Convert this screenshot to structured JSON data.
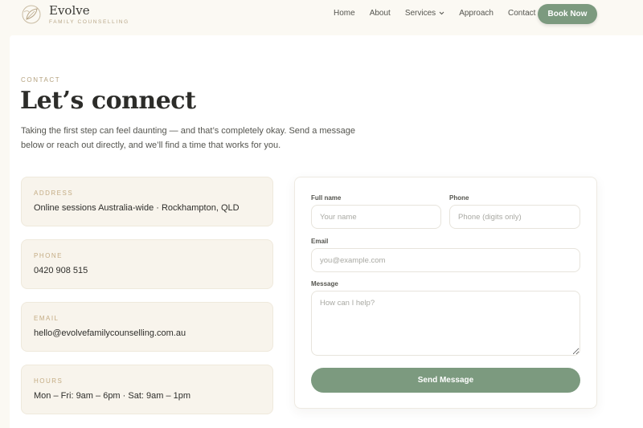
{
  "brand": {
    "name": "Evolve",
    "tagline": "FAMILY COUNSELLING",
    "logo_icon": "leaf-emblem-icon"
  },
  "nav": {
    "items": [
      {
        "label": "Home"
      },
      {
        "label": "About"
      },
      {
        "label": "Services",
        "has_dropdown": true
      },
      {
        "label": "Approach"
      },
      {
        "label": "Contact"
      }
    ],
    "cta": "Book Now"
  },
  "contact": {
    "eyebrow": "CONTACT",
    "title": "Let’s connect",
    "intro": "Taking the first step can feel daunting — and that’s completely okay. Send a message below or reach out directly, and we’ll find a time that works for you.",
    "cards": [
      {
        "label": "ADDRESS",
        "value": "Online sessions Australia-wide · Rockhampton, QLD"
      },
      {
        "label": "PHONE",
        "value": "0420 908 515"
      },
      {
        "label": "EMAIL",
        "value": "hello@evolvefamilycounselling.com.au"
      },
      {
        "label": "HOURS",
        "value": "Mon – Fri: 9am – 6pm · Sat: 9am – 1pm"
      }
    ]
  },
  "form": {
    "name_label": "Full name",
    "name_placeholder": "Your name",
    "phone_label": "Phone",
    "phone_placeholder": "Phone (digits only)",
    "email_label": "Email",
    "email_placeholder": "you@example.com",
    "message_label": "Message",
    "message_placeholder": "How can I help?",
    "submit": "Send Message"
  },
  "colors": {
    "accent": "#7c9a7f",
    "background": "#fbf9f3",
    "card": "#f8f4ec",
    "label_gold": "#c4ac84"
  }
}
